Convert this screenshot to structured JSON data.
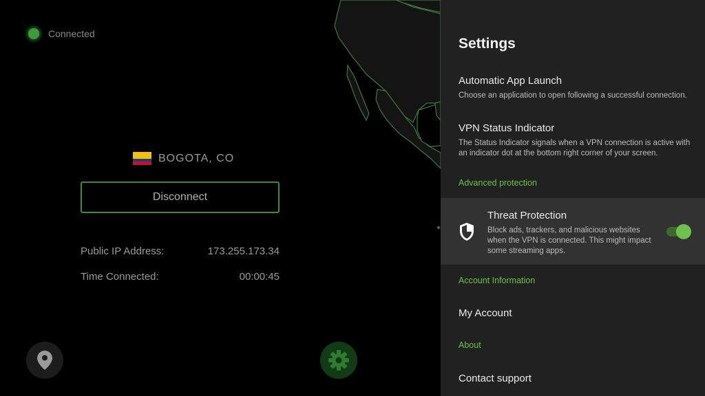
{
  "status": {
    "text": "Connected"
  },
  "location": {
    "name": "BOGOTA, CO"
  },
  "actions": {
    "disconnect_label": "Disconnect"
  },
  "info": {
    "ip_label": "Public IP Address:",
    "ip_value": "173.255.173.34",
    "time_label": "Time Connected:",
    "time_value": "00:00:45"
  },
  "settings": {
    "title": "Settings",
    "auto_launch": {
      "title": "Automatic App Launch",
      "desc": "Choose an application to open following a successful connection."
    },
    "status_indicator": {
      "title": "VPN Status Indicator",
      "desc": "The Status Indicator signals when a VPN connection is active with an indicator dot at the bottom right corner of your screen."
    },
    "sections": {
      "advanced": "Advanced protection",
      "account": "Account Information",
      "about": "About"
    },
    "threat": {
      "title": "Threat Protection",
      "desc": "Block ads, trackers, and malicious websites when the VPN is connected. This might impact some streaming apps.",
      "enabled": true
    },
    "my_account": "My Account",
    "contact_support": "Contact support"
  },
  "colors": {
    "accent": "#6cc24a",
    "connected_dot": "#3d9a3d",
    "panel_bg": "#212121",
    "highlight_bg": "#323232"
  },
  "icons": [
    "status-dot",
    "colombia-flag-icon",
    "location-pin-icon",
    "gear-icon",
    "shield-icon"
  ]
}
